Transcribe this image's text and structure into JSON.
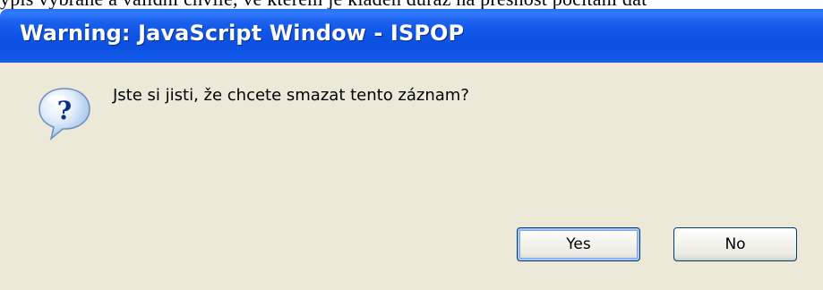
{
  "background": {
    "clipped_text": "ýpis vybrané a validní chvíle, ve kterém je kladen důraz na přesnost počítání dat"
  },
  "dialog": {
    "title": "Warning: JavaScript Window - ISPOP",
    "message": "Jste si jisti, že chcete smazat tento záznam?",
    "icon": "question-icon",
    "buttons": {
      "yes_label": "Yes",
      "no_label": "No"
    }
  },
  "colors": {
    "titlebar": "#0b50e0",
    "body": "#ece9d8",
    "button_border": "#003c74"
  }
}
